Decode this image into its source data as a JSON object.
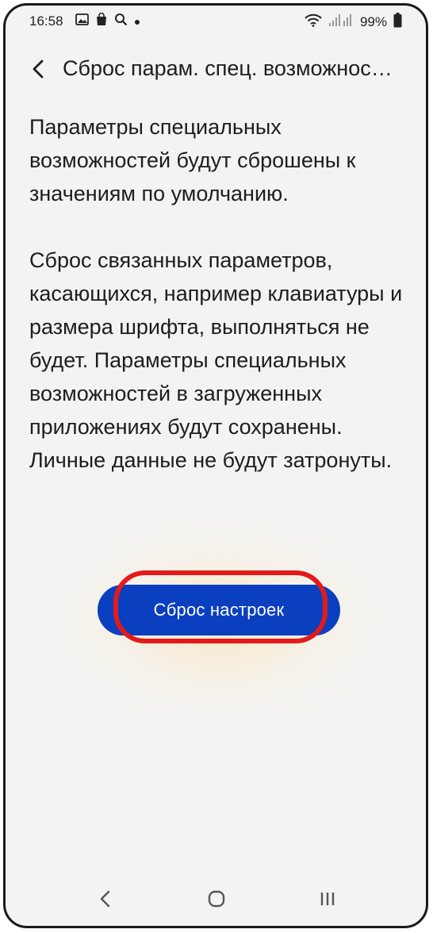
{
  "status_bar": {
    "time": "16:58",
    "icons": [
      "image-icon",
      "shopping-bag-icon",
      "search-icon",
      "dot-icon",
      "wifi-icon",
      "signal-icon",
      "battery-icon"
    ],
    "battery_percent": "99%"
  },
  "header": {
    "back_icon": "back-arrow-icon",
    "title": "Сброс парам. спец. возможнос…"
  },
  "main": {
    "paragraph_1": "Параметры специальных возможностей будут сброшены к значениям по умолчанию.",
    "paragraph_2": "Сброс связанных параметров, касающихся, например клавиатуры и размера шрифта, выполняться не будет. Параметры специальных возможностей в загруженных приложениях будут сохранены. Личные данные не будут затронуты.",
    "reset_button_label": "Сброс настроек"
  },
  "nav_bar": {
    "icons": [
      "nav-back-icon",
      "nav-home-icon",
      "nav-recents-icon"
    ]
  },
  "colors": {
    "accent_button": "#0a3fbf",
    "highlight_ring": "#e31a1a",
    "background": "#f3f3f3"
  }
}
